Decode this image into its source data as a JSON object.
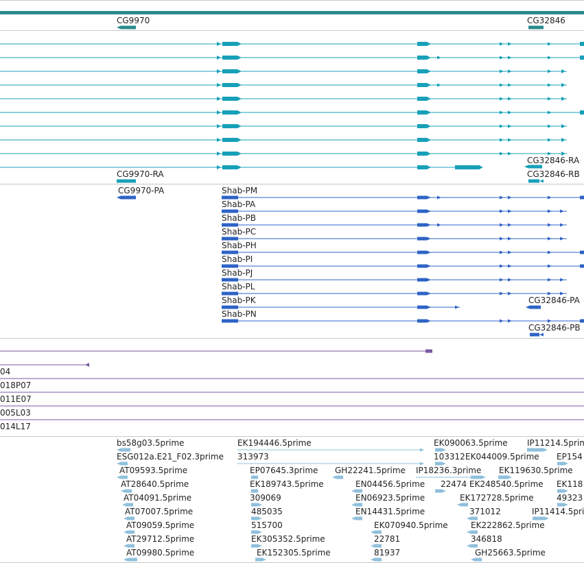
{
  "colors": {
    "gene": "#2a8b8b",
    "transcript": "#17a0b8",
    "protein": "#2e63c5",
    "cdna": "#7a5aa0",
    "est": "#8fc0dc",
    "divider": "#c8c8c8"
  },
  "genes": [
    {
      "name": "CG9970"
    },
    {
      "name": "CG32846"
    }
  ],
  "transcripts": [
    {
      "name": "CG9970-RA"
    },
    {
      "name": "CG32846-RA"
    },
    {
      "name": "CG32846-RB"
    }
  ],
  "proteins": [
    {
      "name": "CG9970-PA"
    },
    {
      "name": "Shab-PM"
    },
    {
      "name": "Shab-PA"
    },
    {
      "name": "Shab-PB"
    },
    {
      "name": "Shab-PC"
    },
    {
      "name": "Shab-PH"
    },
    {
      "name": "Shab-PI"
    },
    {
      "name": "Shab-PJ"
    },
    {
      "name": "Shab-PL"
    },
    {
      "name": "Shab-PK"
    },
    {
      "name": "Shab-PN"
    },
    {
      "name": "CG32846-PA"
    },
    {
      "name": "CG32846-PB"
    }
  ],
  "cdna_clones": [
    {
      "name": "04"
    },
    {
      "name": "018P07"
    },
    {
      "name": "011E07"
    },
    {
      "name": "005L03"
    },
    {
      "name": "014L17"
    }
  ],
  "ests": [
    {
      "name": "bs58g03.5prime"
    },
    {
      "name": "ESG012a.E21_F02.3prime"
    },
    {
      "name": "AT09593.5prime"
    },
    {
      "name": "AT28640.5prime"
    },
    {
      "name": "AT04091.5prime"
    },
    {
      "name": "AT07007.5prime"
    },
    {
      "name": "AT09059.5prime"
    },
    {
      "name": "AT29712.5prime"
    },
    {
      "name": "AT09980.5prime"
    },
    {
      "name": "EK194446.5prime"
    },
    {
      "name": "313973"
    },
    {
      "name": "EP07645.3prime"
    },
    {
      "name": "EK189743.5prime"
    },
    {
      "name": "309069"
    },
    {
      "name": "485035"
    },
    {
      "name": "515700"
    },
    {
      "name": "EK305352.5prime"
    },
    {
      "name": "EK152305.5prime"
    },
    {
      "name": "GH22241.5prime"
    },
    {
      "name": "EN04456.5prime"
    },
    {
      "name": "EN06923.5prime"
    },
    {
      "name": "EN14431.5prime"
    },
    {
      "name": "EK070940.5prime"
    },
    {
      "name": "22781"
    },
    {
      "name": "81937"
    },
    {
      "name": "EK090063.5prime"
    },
    {
      "name": "103312"
    },
    {
      "name": "EK044009.5prime"
    },
    {
      "name": "IP18236.3prime"
    },
    {
      "name": "22474"
    },
    {
      "name": "EK248540.5prime"
    },
    {
      "name": "EK172728.5prime"
    },
    {
      "name": "371012"
    },
    {
      "name": "EK222862.5prime"
    },
    {
      "name": "346818"
    },
    {
      "name": "GH25663.5prime"
    },
    {
      "name": "EK119630.5prime"
    },
    {
      "name": "IP11214.5prim"
    },
    {
      "name": "EP154"
    },
    {
      "name": "EK118"
    },
    {
      "name": "49323"
    },
    {
      "name": "IP11414.5pri"
    }
  ]
}
